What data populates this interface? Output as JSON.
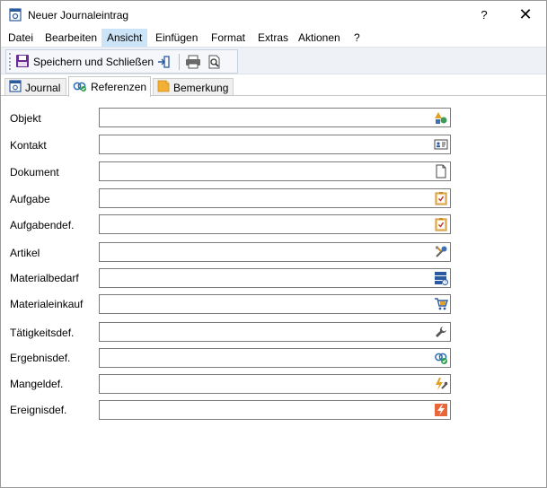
{
  "window": {
    "title": "Neuer Journaleintrag",
    "help_label": "?",
    "close_label": "✕"
  },
  "menu": {
    "items": [
      "Datei",
      "Bearbeiten",
      "Ansicht",
      "Einfügen",
      "Format",
      "Extras",
      "Aktionen",
      "?"
    ],
    "active": "Ansicht"
  },
  "toolbar": {
    "save_close_label": "Speichern und Schließen"
  },
  "tabs": [
    {
      "label": "Journal",
      "icon": "journal-icon"
    },
    {
      "label": "Referenzen",
      "icon": "references-icon",
      "selected": true
    },
    {
      "label": "Bemerkung",
      "icon": "note-icon"
    }
  ],
  "fields": [
    {
      "label": "Objekt",
      "value": "",
      "icon": "object-icon"
    },
    {
      "label": "Kontakt",
      "value": "",
      "icon": "contact-card-icon"
    },
    {
      "label": "Dokument",
      "value": "",
      "icon": "document-icon"
    },
    {
      "label": "Aufgabe",
      "value": "",
      "icon": "task-clipboard-icon"
    },
    {
      "label": "Aufgabendef.",
      "value": "",
      "icon": "task-definition-icon"
    },
    {
      "label": "Artikel",
      "value": "",
      "icon": "article-tools-icon"
    },
    {
      "label": "Materialbedarf",
      "value": "",
      "icon": "material-demand-icon"
    },
    {
      "label": "Materialeinkauf",
      "value": "",
      "icon": "material-purchase-icon"
    },
    {
      "label": "Tätigkeitsdef.",
      "value": "",
      "icon": "wrench-icon"
    },
    {
      "label": "Ergebnisdef.",
      "value": "",
      "icon": "result-check-icon"
    },
    {
      "label": "Mangeldef.",
      "value": "",
      "icon": "defect-icon"
    },
    {
      "label": "Ereignisdef.",
      "value": "",
      "icon": "event-lightning-icon"
    }
  ],
  "colors": {
    "menu_active": "#cce4f7",
    "toolbar_bg": "#eef1f6",
    "field_border": "#7a7a7a"
  }
}
